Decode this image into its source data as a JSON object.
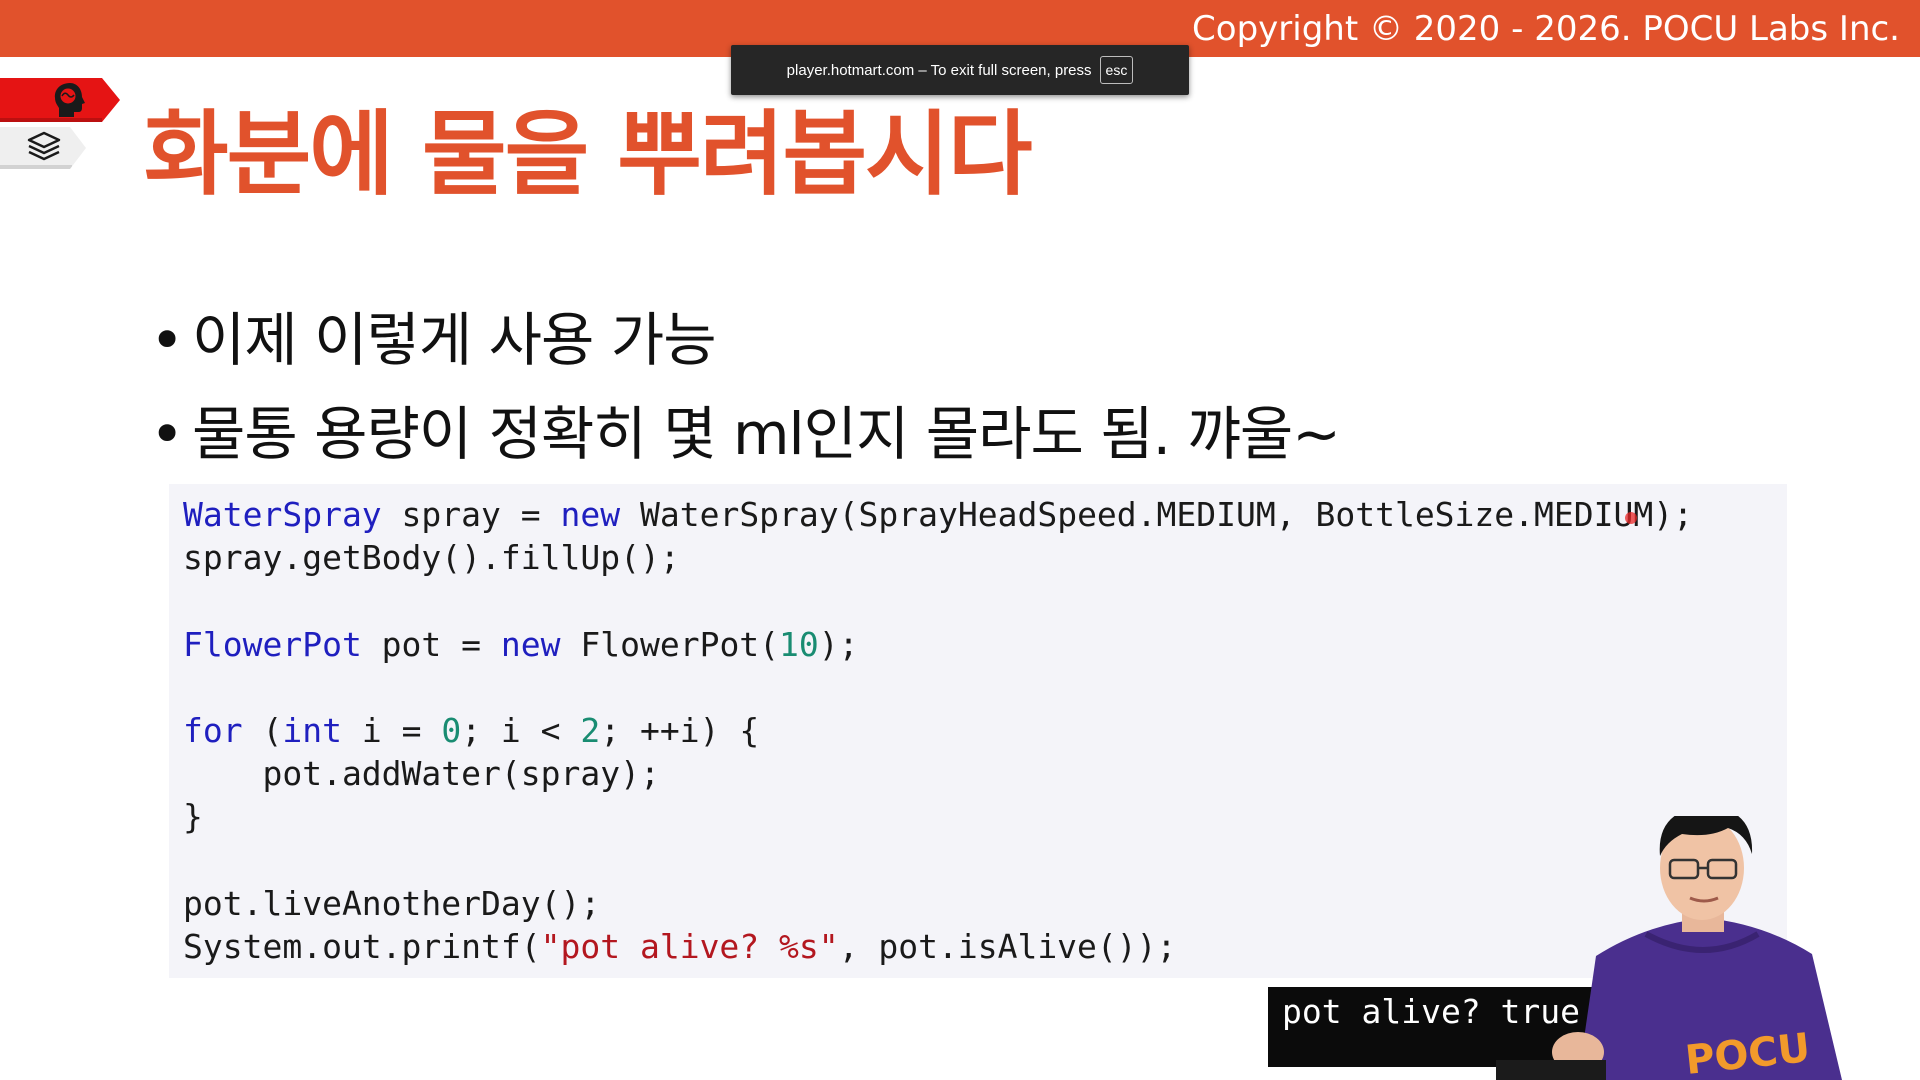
{
  "header": {
    "copyright": "Copyright © 2020 - 2026. POCU Labs Inc.",
    "accent_color": "#e1522c"
  },
  "fullscreen_notice": {
    "message": "player.hotmart.com – To exit full screen, press",
    "key": "esc"
  },
  "side_tags": {
    "top_icon": "brain-head-icon",
    "bottom_icon": "book-stack-icon"
  },
  "slide": {
    "title": "화분에 물을 뿌려봅시다",
    "bullets": [
      {
        "marker": "•",
        "text": "이제 이렇게 사용 가능"
      },
      {
        "marker": "•",
        "text": "물통 용량이 정확히 몇 ml인지 몰라도 됨. 꺄울~"
      }
    ]
  },
  "code": {
    "language": "java",
    "lines": [
      [
        {
          "t": "WaterSpray",
          "c": "kw"
        },
        {
          "t": " spray = "
        },
        {
          "t": "new",
          "c": "kw"
        },
        {
          "t": " WaterSpray(SprayHeadSpeed.MEDIUM, BottleSize.MEDIUM);"
        }
      ],
      [
        {
          "t": "spray.getBody().fillUp();"
        }
      ],
      [
        {
          "t": ""
        }
      ],
      [
        {
          "t": "FlowerPot",
          "c": "kw"
        },
        {
          "t": " pot = "
        },
        {
          "t": "new",
          "c": "kw"
        },
        {
          "t": " FlowerPot("
        },
        {
          "t": "10",
          "c": "num"
        },
        {
          "t": ");"
        }
      ],
      [
        {
          "t": ""
        }
      ],
      [
        {
          "t": "for",
          "c": "kw"
        },
        {
          "t": " ("
        },
        {
          "t": "int",
          "c": "kw"
        },
        {
          "t": " i = "
        },
        {
          "t": "0",
          "c": "num"
        },
        {
          "t": "; i < "
        },
        {
          "t": "2",
          "c": "num"
        },
        {
          "t": "; ++i) {"
        }
      ],
      [
        {
          "t": "    pot.addWater(spray);"
        }
      ],
      [
        {
          "t": "}"
        }
      ],
      [
        {
          "t": ""
        }
      ],
      [
        {
          "t": "pot.liveAnotherDay();"
        }
      ],
      [
        {
          "t": "System.out.printf("
        },
        {
          "t": "\"pot alive? %s\"",
          "c": "str"
        },
        {
          "t": ", pot.isAlive());"
        }
      ]
    ]
  },
  "console": {
    "output": "pot alive? true"
  },
  "presenter": {
    "shirt_logo": "POCU"
  }
}
